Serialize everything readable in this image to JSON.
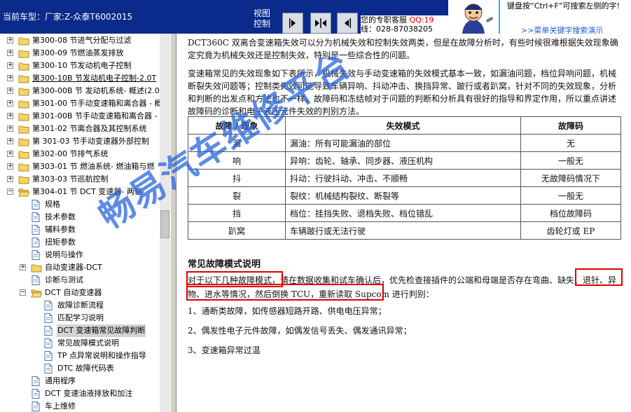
{
  "header": {
    "car_model": "当前车型：厂家:Z-众泰T6002015",
    "view_control": "视图控制",
    "nav_buttons": [
      "show-left-pane",
      "show-both-panes",
      "show-right-pane"
    ],
    "service_line1": "您的专职客服",
    "service_qq": "QQ:19",
    "service_line2": "线：028-87038205",
    "hint_text": "键盘按“Ctrl+F”可搜索左侧的字!",
    "hint_link": ">>菜单关键字搜索演示"
  },
  "tree": [
    {
      "label": "第300-08 节进气分配与过滤",
      "level": 0,
      "icon": "folder-icon",
      "expander": "+"
    },
    {
      "label": "第300-09 节燃油蒸发排放",
      "level": 0,
      "icon": "folder-icon",
      "expander": "+"
    },
    {
      "label": "第300-10 节发动机电子控制",
      "level": 0,
      "icon": "folder-icon",
      "expander": "+"
    },
    {
      "label": "第300-10B 节发动机电子控制-2.0T",
      "level": 0,
      "icon": "folder-icon",
      "expander": "+",
      "underline": true
    },
    {
      "label": "第300-00B 节 发动机系统- 概述(2.0",
      "level": 0,
      "icon": "folder-icon",
      "expander": "+"
    },
    {
      "label": "第301-00 节手动变速箱和离合器 - 概",
      "level": 0,
      "icon": "folder-icon",
      "expander": "+"
    },
    {
      "label": "第301-00B 节手动变速箱和离合器 -",
      "level": 0,
      "icon": "folder-icon",
      "expander": "+"
    },
    {
      "label": "第301-02 节离合器及其控制系统",
      "level": 0,
      "icon": "folder-icon",
      "expander": "+"
    },
    {
      "label": "第 301-03 节手动变速器外部控制",
      "level": 0,
      "icon": "folder-icon",
      "expander": "+"
    },
    {
      "label": "第302-00 节排气系统",
      "level": 0,
      "icon": "folder-icon",
      "expander": "+"
    },
    {
      "label": "第303-01 节 燃油系统- 燃油箱与燃",
      "level": 0,
      "icon": "folder-icon",
      "expander": "+"
    },
    {
      "label": "第303-03 节巡航控制",
      "level": 0,
      "icon": "folder-icon",
      "expander": "+"
    },
    {
      "label": "第304-01 节 DCT 变速器- 两驱",
      "level": 0,
      "icon": "folder-open-icon",
      "expander": "-"
    },
    {
      "label": "规格",
      "level": 1,
      "icon": "document-icon",
      "expander": ""
    },
    {
      "label": "技术参数",
      "level": 1,
      "icon": "document-icon",
      "expander": ""
    },
    {
      "label": "辅料参数",
      "level": 1,
      "icon": "document-icon",
      "expander": ""
    },
    {
      "label": "扭矩参数",
      "level": 1,
      "icon": "document-icon",
      "expander": ""
    },
    {
      "label": "说明与操作",
      "level": 1,
      "icon": "document-icon",
      "expander": ""
    },
    {
      "label": "自动变速器-DCT",
      "level": 1,
      "icon": "folder-icon",
      "expander": "+"
    },
    {
      "label": "诊断与测试",
      "level": 1,
      "icon": "document-icon",
      "expander": ""
    },
    {
      "label": "DCT 自动变速器",
      "level": 1,
      "icon": "folder-open-icon",
      "expander": "-"
    },
    {
      "label": "故障诊断流程",
      "level": 2,
      "icon": "document-icon",
      "expander": ""
    },
    {
      "label": "匹配学习说明",
      "level": 2,
      "icon": "document-icon",
      "expander": ""
    },
    {
      "label": "DCT 变速箱常见故障判断",
      "level": 2,
      "icon": "document-icon",
      "expander": "",
      "selected": true
    },
    {
      "label": "常见故障模式说明",
      "level": 2,
      "icon": "document-icon",
      "expander": ""
    },
    {
      "label": "TP 点异常说明和操作指导",
      "level": 2,
      "icon": "document-icon",
      "expander": ""
    },
    {
      "label": "DTC 故障代码表",
      "level": 2,
      "icon": "document-icon",
      "expander": ""
    },
    {
      "label": "通用程序",
      "level": 1,
      "icon": "document-icon",
      "expander": ""
    },
    {
      "label": "DCT 变速油液排放和加注",
      "level": 1,
      "icon": "document-icon",
      "expander": ""
    },
    {
      "label": "车上维修",
      "level": 1,
      "icon": "document-icon",
      "expander": ""
    }
  ],
  "content": {
    "intro": "DCT360C 双离合变速箱失效可以分为机械失效和控制失效两类，但是在故障分析时，有些时候很难根据失效现象确定究竟为机械失效还是控制失效，特别是一些综合性的问题。",
    "para2": "变速箱常见的失效现象如下表所示，机械失效与手动变速箱的失效模式基本一致，如漏油问题，档位异响问题，机械断裂失效问题等；控制类失效可能导致车辆异响、抖动冲击、换挡异常、跛行或者趴窝，针对不同的失效现象，分析和判断的出发点和方法也不一样。故障码和冻结帧对于问题的判断和分析具有很好的指导和界定作用，所以重点讲述故障码的诊断和电子液压元件失效的判别方法。",
    "table_headers": [
      "故障 / 现象",
      "失效模式",
      "故障码"
    ],
    "table_rows": [
      [
        "漏",
        "漏油：所有可能漏油的部位",
        "无"
      ],
      [
        "响",
        "异响：齿轮、轴承、同步器、液压机构",
        "一般无"
      ],
      [
        "抖",
        "抖动：行驶抖动、冲击、不顺畅",
        "无故障码情况下"
      ],
      [
        "裂",
        "裂纹：机械结构裂纹、断裂等",
        "一般无"
      ],
      [
        "挡",
        "档位：挂挡失败、退档失败、档位错乱",
        "档位故障码"
      ],
      [
        "趴窝",
        "车辆跛行或无法行驶",
        "齿轮灯或 EP"
      ]
    ],
    "section_title": "常见故障模式说明",
    "para3": "对于以下几种故障模式，请在数据收集和试车确认后，优先检查接插件的公端和母端是否存在弯曲、缺失、退针、异物、进水等情况，然后倒换 TCU，重新读取 Supcom 进行判别：",
    "list": [
      "1、通断类故障，如传感器短路开路、供电电压异常；",
      "2、偶发性电子元件故障，如偶发信号丢失、偶发通讯异常；",
      "3、变速箱异常过温"
    ]
  },
  "watermark": "畅易汽车维修平台",
  "colors": {
    "header_bg": "#0a2a8c",
    "highlight_box": "#e00000",
    "watermark": "#2864dc",
    "selected_bg": "#d3d3d3"
  }
}
